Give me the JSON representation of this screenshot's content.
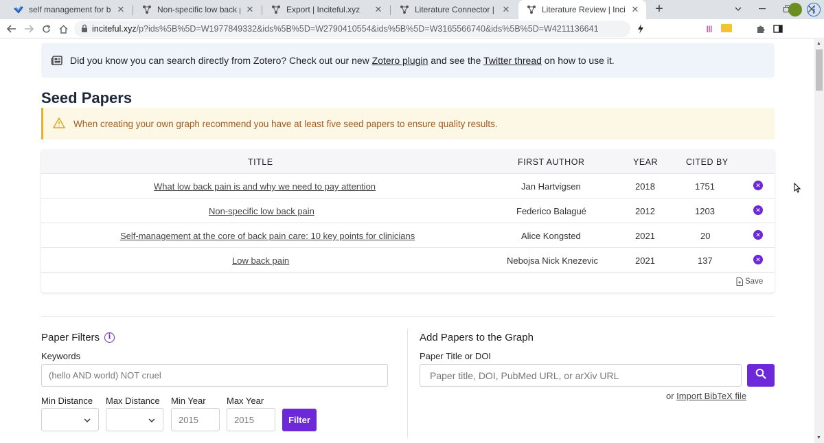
{
  "browser": {
    "tabs": [
      {
        "label": "self management for back pain -",
        "icon": "semantic-scholar-icon"
      },
      {
        "label": "Non-specific low back pain | Incit",
        "icon": "inciteful-icon"
      },
      {
        "label": "Export | Inciteful.xyz",
        "icon": "inciteful-icon"
      },
      {
        "label": "Literature Connector | Inciteful.xy",
        "icon": "inciteful-icon"
      },
      {
        "label": "Literature Review | Inciteful.xyz",
        "icon": "inciteful-icon",
        "active": true
      }
    ],
    "url_host": "inciteful.xyz",
    "url_path": "/p?ids%5B%5D=W1977849332&ids%5B%5D=W2790410554&ids%5B%5D=W3165566740&ids%5B%5D=W4211136641",
    "extensions": [
      {
        "name": "opera-icon",
        "text": "O",
        "color": "#e0201b"
      },
      {
        "name": "adblock-icon",
        "text": "ABP",
        "color": "#e0301e"
      },
      {
        "name": "extension-blue-icon",
        "text": "G",
        "color": "#1a73e8"
      },
      {
        "name": "library-icon",
        "text": "|||",
        "color": "#c13584"
      },
      {
        "name": "folder-icon",
        "text": "",
        "color": "#f4c430"
      },
      {
        "name": "pdf-icon",
        "text": "A",
        "color": "#d32f2f"
      }
    ]
  },
  "banner": {
    "text_before": "Did you know you can search directly from Zotero? Check out our new ",
    "link1": "Zotero plugin",
    "text_middle": " and see the ",
    "link2": "Twitter thread",
    "text_after": " on how to use it."
  },
  "seed": {
    "title": "Seed Papers",
    "warning": "When creating your own graph recommend you have at least five seed papers to ensure quality results.",
    "columns": {
      "title": "TITLE",
      "author": "FIRST AUTHOR",
      "year": "YEAR",
      "cited": "CITED BY"
    },
    "rows": [
      {
        "title": "What low back pain is and why we need to pay attention",
        "author": "Jan Hartvigsen",
        "year": "2018",
        "cited": "1751"
      },
      {
        "title": "Non-specific low back pain",
        "author": "Federico Balagué",
        "year": "2012",
        "cited": "1203"
      },
      {
        "title": "Self-management at the core of back pain care: 10 key points for clinicians",
        "author": "Alice Kongsted",
        "year": "2021",
        "cited": "20"
      },
      {
        "title": "Low back pain",
        "author": "Nebojsa Nick Knezevic",
        "year": "2021",
        "cited": "137"
      }
    ],
    "save_label": "Save"
  },
  "filters": {
    "title": "Paper Filters",
    "keywords_label": "Keywords",
    "keywords_placeholder": "(hello AND world) NOT cruel",
    "min_distance_label": "Min Distance",
    "max_distance_label": "Max Distance",
    "min_year_label": "Min Year",
    "max_year_label": "Max Year",
    "min_year_value": "2015",
    "max_year_value": "2015",
    "filter_button": "Filter"
  },
  "add": {
    "title": "Add Papers to the Graph",
    "field_label": "Paper Title or DOI",
    "placeholder": "Paper title, DOI, PubMed URL, or arXiv URL",
    "bibtex_prefix": "or ",
    "bibtex_link": "Import BibTeX file"
  }
}
